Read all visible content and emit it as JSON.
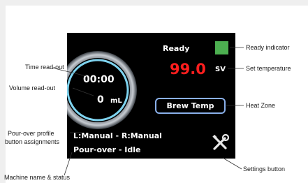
{
  "screen": {
    "time": "00:00",
    "volume": "0",
    "volume_unit": "mL",
    "status": "Ready",
    "set_temperature": "99.0",
    "temperature_unit": "SV",
    "heat_zone_button": "Brew Temp",
    "pour_profile": "L:Manual - R:Manual",
    "machine_status": "Pour-over - Idle",
    "ready_indicator_color": "#4caf50",
    "settings_icon": "wrench-screwdriver-icon"
  },
  "annotations": {
    "time_readout": "Time read-out",
    "volume_readout": "Volume read-out",
    "pour_profile_line1": "Pour-over profile",
    "pour_profile_line2": "button assignments",
    "machine_name": "Machine name & status",
    "ready_indicator": "Ready indicator",
    "set_temperature": "Set temperature",
    "heat_zone": "Heat Zone",
    "settings_button": "Settings button"
  }
}
